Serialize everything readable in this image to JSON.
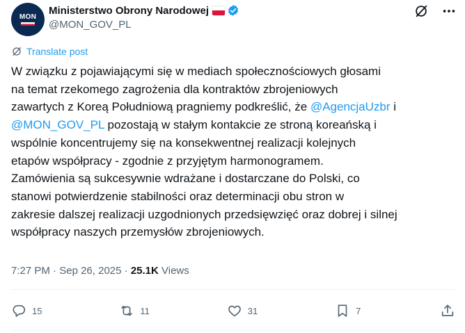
{
  "author": {
    "avatar_text": "MON",
    "display_name": "Ministerstwo Obrony Narodowej",
    "handle": "@MON_GOV_PL"
  },
  "translate_label": "Translate post",
  "tweet": {
    "line1": "W związku z pojawiającymi się w mediach społecznościowych głosami",
    "line2": "na temat rzekomego zagrożenia dla kontraktów zbrojeniowych",
    "line3_pre": "zawartych z Koreą Południową pragniemy podkreślić, że ",
    "mention1": "@AgencjaUzbr",
    "line3_post": " i",
    "mention2": "@MON_GOV_PL",
    "line4_post": " pozostają w stałym kontakcie ze stroną koreańską i",
    "line5": "wspólnie koncentrujemy się na konsekwentnej realizacji kolejnych",
    "line6": "etapów współpracy - zgodnie z przyjętym harmonogramem.",
    "line7": "Zamówienia są sukcesywnie wdrażane i dostarczane do Polski, co",
    "line8": "stanowi potwierdzenie stabilności oraz determinacji obu stron w",
    "line9": "zakresie dalszej realizacji uzgodnionych przedsięwzięć oraz dobrej i silnej",
    "line10": "współpracy naszych przemysłów zbrojeniowych."
  },
  "meta": {
    "time": "7:27 PM",
    "separator": " · ",
    "date": "Sep 26, 2025",
    "views_count": "25.1K",
    "views_label": " Views"
  },
  "actions": {
    "replies": "15",
    "reposts": "11",
    "likes": "31",
    "bookmarks": "7"
  },
  "colors": {
    "accent": "#1d9bf0",
    "text": "#0f1419",
    "secondary": "#536471"
  }
}
